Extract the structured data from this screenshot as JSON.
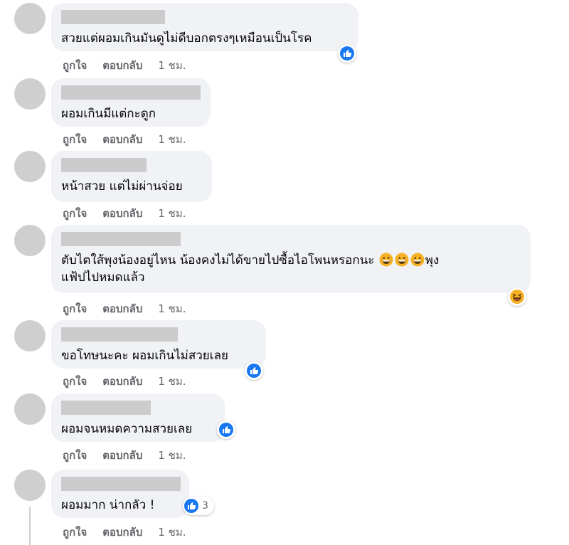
{
  "actions": {
    "like": "ถูกใจ",
    "reply": "ตอบกลับ"
  },
  "comments": [
    {
      "text": "สวยแต่ผอมเกินมันดูไม่ดีบอกตรงๆเหมือนเป็นโรค",
      "time": "1 ชม.",
      "reaction": "like-icon"
    },
    {
      "text": "ผอมเกินมีแต่กะดูก",
      "time": "1 ชม."
    },
    {
      "text": "หน้าสวย แต่ไม่ผ่านจ่อย",
      "time": "1 ชม."
    },
    {
      "text_line1": "ตับไตใส้พุงน้องอยู่ไหน น้องคงไม่ได้ขายไปซื้อไอโพนหรอกนะ",
      "text_line1_end": "พุง",
      "text_line2": "แฟ้ปไปหมดแล้ว",
      "time": "1 ชม.",
      "reaction": "haha-icon",
      "inline_emojis": [
        "grin-emoji",
        "grin-emoji",
        "grin-emoji"
      ]
    },
    {
      "text": "ขอโทษนะคะ ผอมเกินไม่สวยเลย",
      "time": "1 ชม.",
      "reaction": "like-icon"
    },
    {
      "text": "ผอมจนหมดความสวยเลย",
      "time": "1 ชม.",
      "reaction": "like-icon"
    },
    {
      "text": "ผอมมาก น่ากลัว !",
      "time": "1 ชม.",
      "reaction": "like-icon",
      "reaction_count": "3"
    }
  ],
  "colors": {
    "like_blue": "#1877f2",
    "bubble": "#f0f2f5",
    "meta": "#65676b",
    "haha_yellow": "#f7b125"
  }
}
